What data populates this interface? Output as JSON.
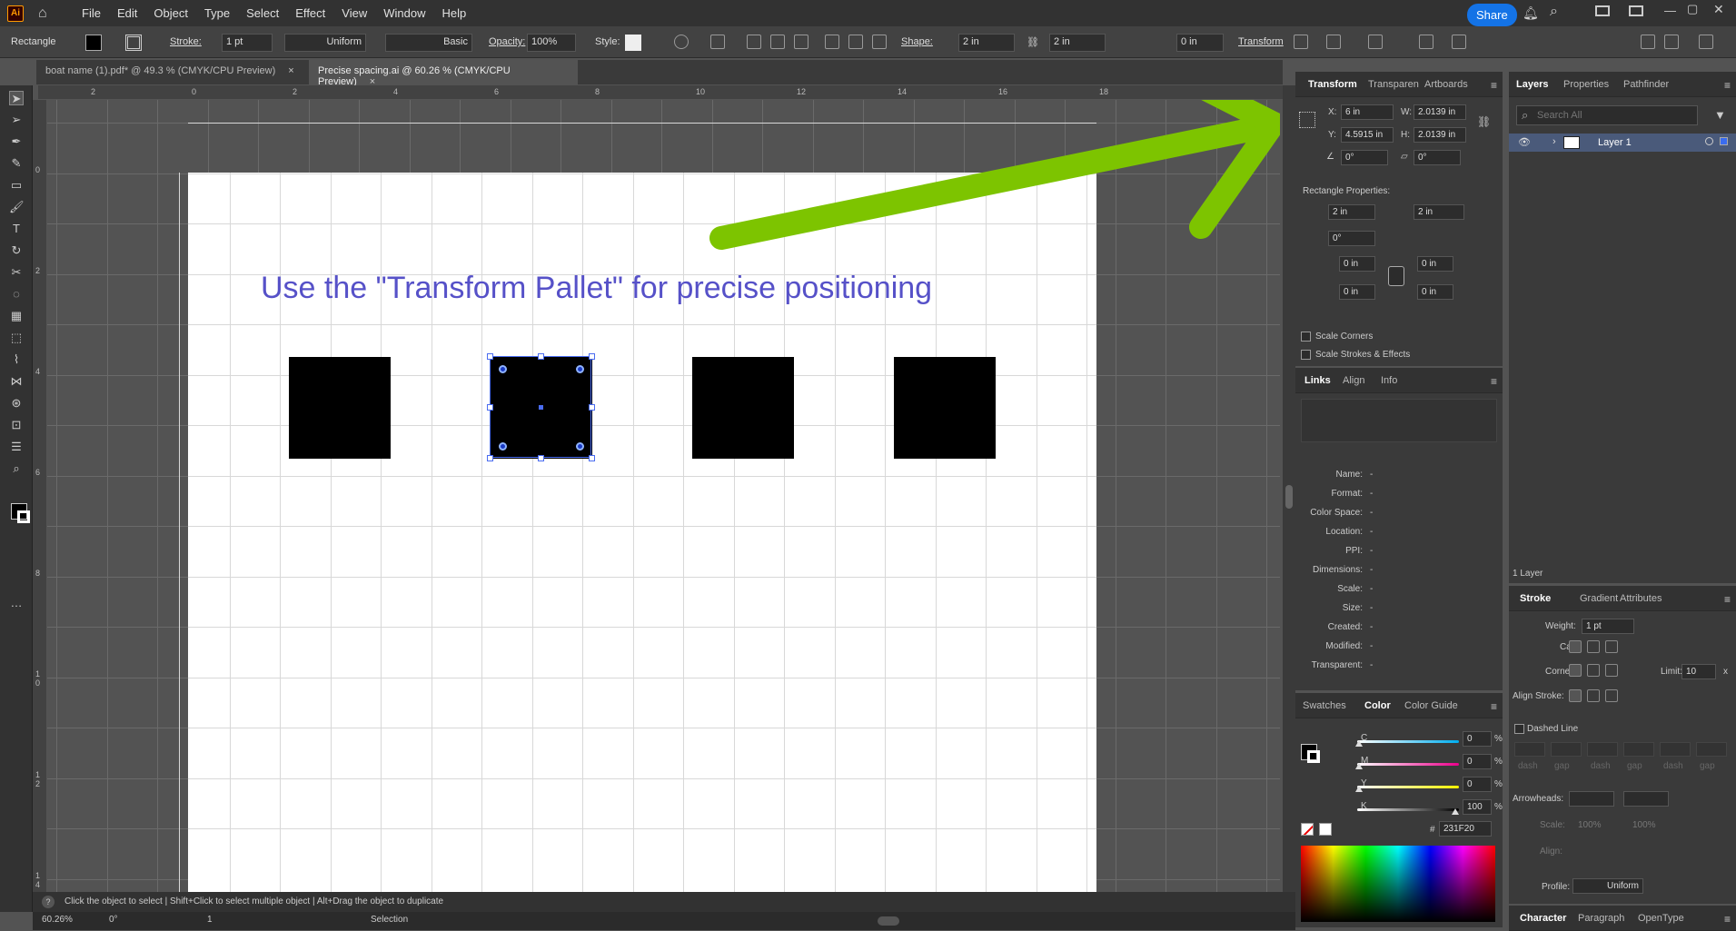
{
  "app": {
    "logo": "Ai",
    "home_icon": "home-icon"
  },
  "menu": [
    "File",
    "Edit",
    "Object",
    "Type",
    "Select",
    "Effect",
    "View",
    "Window",
    "Help"
  ],
  "share_label": "Share",
  "control_bar": {
    "object_type": "Rectangle",
    "stroke_label": "Stroke:",
    "stroke_weight": "1 pt",
    "stroke_profile": "Uniform",
    "brush": "Basic",
    "opacity_label": "Opacity:",
    "opacity": "100%",
    "style_label": "Style:",
    "shape_label": "Shape:",
    "shape_w": "2 in",
    "shape_h": "2 in",
    "corner": "0 in",
    "transform_label": "Transform"
  },
  "tabs": [
    {
      "label": "boat name (1).pdf* @ 49.3 % (CMYK/CPU Preview)",
      "active": false
    },
    {
      "label": "Precise spacing.ai @ 60.26 % (CMYK/CPU Preview)",
      "active": true
    }
  ],
  "close_glyph": "×",
  "ruler_top": [
    "2",
    "0",
    "2",
    "4",
    "6",
    "8",
    "10",
    "12",
    "14",
    "16",
    "18"
  ],
  "ruler_left": [
    "0",
    "2",
    "4",
    "6",
    "8",
    "1 0",
    "1 2",
    "1 4"
  ],
  "canvas": {
    "headline": "Use the \"Transform Pallet\" for precise positioning"
  },
  "arrow_color": "#7dc400",
  "headline_color": "#5651c8",
  "transform_panel": {
    "tabs": [
      "Transform",
      "Transparen",
      "Artboards"
    ],
    "x_label": "X:",
    "x": "6 in",
    "y_label": "Y:",
    "y": "4.5915 in",
    "w_label": "W:",
    "w": "2.0139 in",
    "h_label": "H:",
    "h": "2.0139 in",
    "angle": "0°",
    "shear": "0°",
    "rect_props_label": "Rectangle Properties:",
    "rect_w": "2 in",
    "rect_h": "2 in",
    "rect_angle": "0°",
    "corner_tl": "0 in",
    "corner_tr": "0 in",
    "corner_bl": "0 in",
    "corner_br": "0 in",
    "scale_corners": "Scale Corners",
    "scale_strokes": "Scale Strokes & Effects"
  },
  "links_panel": {
    "tabs": [
      "Links",
      "Align",
      "Info"
    ],
    "fields": [
      {
        "label": "Name:",
        "value": "-"
      },
      {
        "label": "Format:",
        "value": "-"
      },
      {
        "label": "Color Space:",
        "value": "-"
      },
      {
        "label": "Location:",
        "value": "-"
      },
      {
        "label": "PPI:",
        "value": "-"
      },
      {
        "label": "Dimensions:",
        "value": "-"
      },
      {
        "label": "Scale:",
        "value": "-"
      },
      {
        "label": "Size:",
        "value": "-"
      },
      {
        "label": "Created:",
        "value": "-"
      },
      {
        "label": "Modified:",
        "value": "-"
      },
      {
        "label": "Transparent:",
        "value": "-"
      }
    ]
  },
  "color_panel": {
    "tabs": [
      "Swatches",
      "Color",
      "Color Guide"
    ],
    "channels": [
      {
        "label": "C",
        "value": "0",
        "pct": "%",
        "level": 0
      },
      {
        "label": "M",
        "value": "0",
        "pct": "%",
        "level": 0
      },
      {
        "label": "Y",
        "value": "0",
        "pct": "%",
        "level": 0
      },
      {
        "label": "K",
        "value": "100",
        "pct": "%",
        "level": 1
      }
    ],
    "hex_label": "#",
    "hex": "231F20"
  },
  "layers_panel": {
    "tabs": [
      "Layers",
      "Properties",
      "Pathfinder"
    ],
    "search_placeholder": "Search All",
    "layer_name": "Layer 1",
    "count": "1 Layer"
  },
  "stroke_panel": {
    "tabs": [
      "Stroke",
      "Gradient",
      "Attributes"
    ],
    "weight_label": "Weight:",
    "weight": "1 pt",
    "cap_label": "Cap:",
    "corner_label": "Corner:",
    "limit_label": "Limit:",
    "limit": "10",
    "limit_x": "x",
    "align_label": "Align Stroke:",
    "dashed_label": "Dashed Line",
    "dash_labels": [
      "dash",
      "gap",
      "dash",
      "gap",
      "dash",
      "gap"
    ],
    "arrowheads_label": "Arrowheads:",
    "scale_label": "Scale:",
    "scale1": "100%",
    "scale2": "100%",
    "align2_label": "Align:",
    "profile_label": "Profile:",
    "profile": "Uniform"
  },
  "char_panel": {
    "tabs": [
      "Character",
      "Paragraph",
      "OpenType"
    ]
  },
  "status": {
    "help": "?",
    "hint": "Click the object to select  |  Shift+Click to select multiple object  |  Alt+Drag the object to duplicate",
    "zoom": "60.26%",
    "rotation": "0°",
    "artboard": "1",
    "tool": "Selection"
  }
}
